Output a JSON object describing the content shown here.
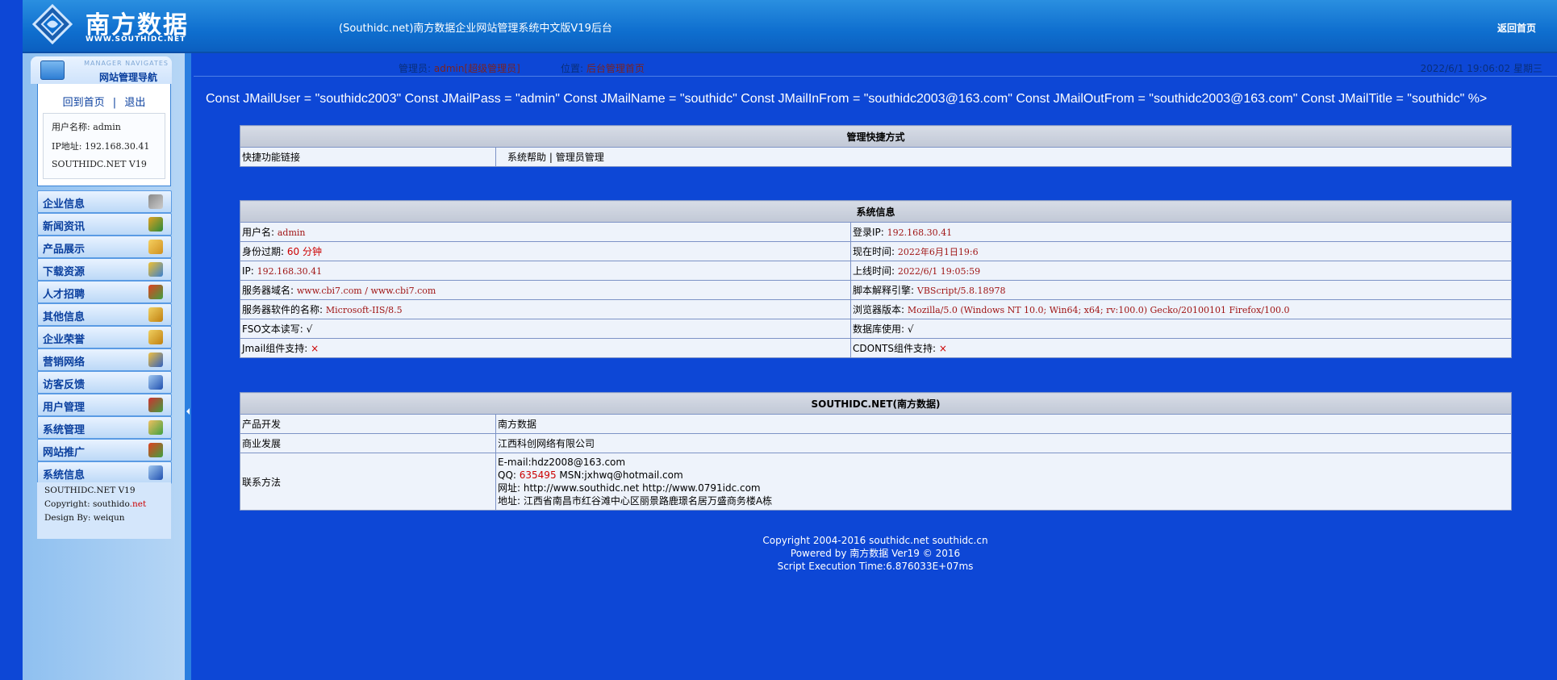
{
  "header": {
    "logo_text": "南方数据",
    "logo_url": "WWW.SOUTHIDC.NET",
    "system_title": "(Southidc.net)南方数据企业网站管理系统中文版V19后台",
    "back_home": "返回首页"
  },
  "sidebar": {
    "nav_title_en": "MANAGER NAVIGATES",
    "nav_title_cn": "网站管理导航",
    "home_link": "回到首页",
    "separator": "|",
    "logout_link": "退出",
    "user_name": "用户名称: admin",
    "ip": "IP地址: 192.168.30.41",
    "version": "SOUTHIDC.NET V19",
    "items": [
      {
        "label": "企业信息",
        "icon": "tools-icon"
      },
      {
        "label": "新闻资讯",
        "icon": "users-icon"
      },
      {
        "label": "产品展示",
        "icon": "lock-icon"
      },
      {
        "label": "下载资源",
        "icon": "gears-icon"
      },
      {
        "label": "人才招聘",
        "icon": "refresh-icon"
      },
      {
        "label": "其他信息",
        "icon": "edit-icon"
      },
      {
        "label": "企业荣誉",
        "icon": "edit-icon"
      },
      {
        "label": "营销网络",
        "icon": "network-icon"
      },
      {
        "label": "访客反馈",
        "icon": "info-icon"
      },
      {
        "label": "用户管理",
        "icon": "user-admin-icon"
      },
      {
        "label": "系统管理",
        "icon": "system-icon"
      },
      {
        "label": "网站推广",
        "icon": "refresh-icon"
      },
      {
        "label": "系统信息",
        "icon": "info-icon"
      }
    ],
    "footer": {
      "line1": "SOUTHIDC.NET V19",
      "copyright_prefix": "Copyright: southido",
      "copyright_suffix": ".net",
      "design": "Design By:  weiqun"
    }
  },
  "status": {
    "admin_label": "管理员:",
    "admin_value": "admin[超级管理员]",
    "position_label": "位置:",
    "position_value": "后台管理首页",
    "datetime": "2022/6/1 19:06:02 星期三"
  },
  "code_text": "Const JMailUser = \"southidc2003\" Const JMailPass = \"admin\" Const JMailName = \"southidc\" Const JMailInFrom = \"southidc2003@163.com\" Const JMailOutFrom = \"southidc2003@163.com\" Const JMailTitle = \"southidc\" %>",
  "shortcuts": {
    "title": "管理快捷方式",
    "label": "快捷功能链接",
    "link1": "系统帮助",
    "sep": "|",
    "link2": "管理员管理"
  },
  "system_info": {
    "title": "系统信息",
    "rows": [
      {
        "l_label": "用户名:",
        "l_value": "admin",
        "r_label": "登录IP:",
        "r_value": "192.168.30.41"
      },
      {
        "l_label": "身份过期:",
        "l_value": "60 分钟",
        "r_label": "现在时间:",
        "r_value": "2022年6月1日19:6"
      },
      {
        "l_label": "IP:",
        "l_value": "192.168.30.41",
        "r_label": "上线时间:",
        "r_value": "2022/6/1 19:05:59"
      },
      {
        "l_label": "服务器域名:",
        "l_value": "www.cbi7.com / www.cbi7.com",
        "r_label": "脚本解释引擎:",
        "r_value": "VBScript/5.8.18978"
      },
      {
        "l_label": "服务器软件的名称:",
        "l_value": "Microsoft-IIS/8.5",
        "r_label": "浏览器版本:",
        "r_value": "Mozilla/5.0 (Windows NT 10.0; Win64; x64; rv:100.0) Gecko/20100101 Firefox/100.0"
      },
      {
        "l_label": "FSO文本读写:",
        "l_value": "√",
        "r_label": "数据库使用:",
        "r_value": "√"
      },
      {
        "l_label": "Jmail组件支持:",
        "l_value": "×",
        "r_label": "CDONTS组件支持:",
        "r_value": "×"
      }
    ]
  },
  "about": {
    "title": "SOUTHIDC.NET(南方数据)",
    "dev_label": "产品开发",
    "dev_value": "南方数据",
    "biz_label": "商业发展",
    "biz_value": "江西科创网络有限公司",
    "contact_label": "联系方法",
    "email": "E-mail:hdz2008@163.com",
    "qq_prefix": "QQ:",
    "qq_value": "635495",
    "msn": "MSN:jxhwq@hotmail.com",
    "website": "网址:  http://www.southidc.net http://www.0791idc.com",
    "address": "地址:  江西省南昌市红谷滩中心区丽景路鹿璟名居万盛商务楼A栋"
  },
  "footer": {
    "line1": "Copyright 2004-2016 southidc.net southidc.cn",
    "line2": "Powered by 南方数据 Ver19 © 2016",
    "line3": "Script Execution Time:6.876033E+07ms"
  }
}
